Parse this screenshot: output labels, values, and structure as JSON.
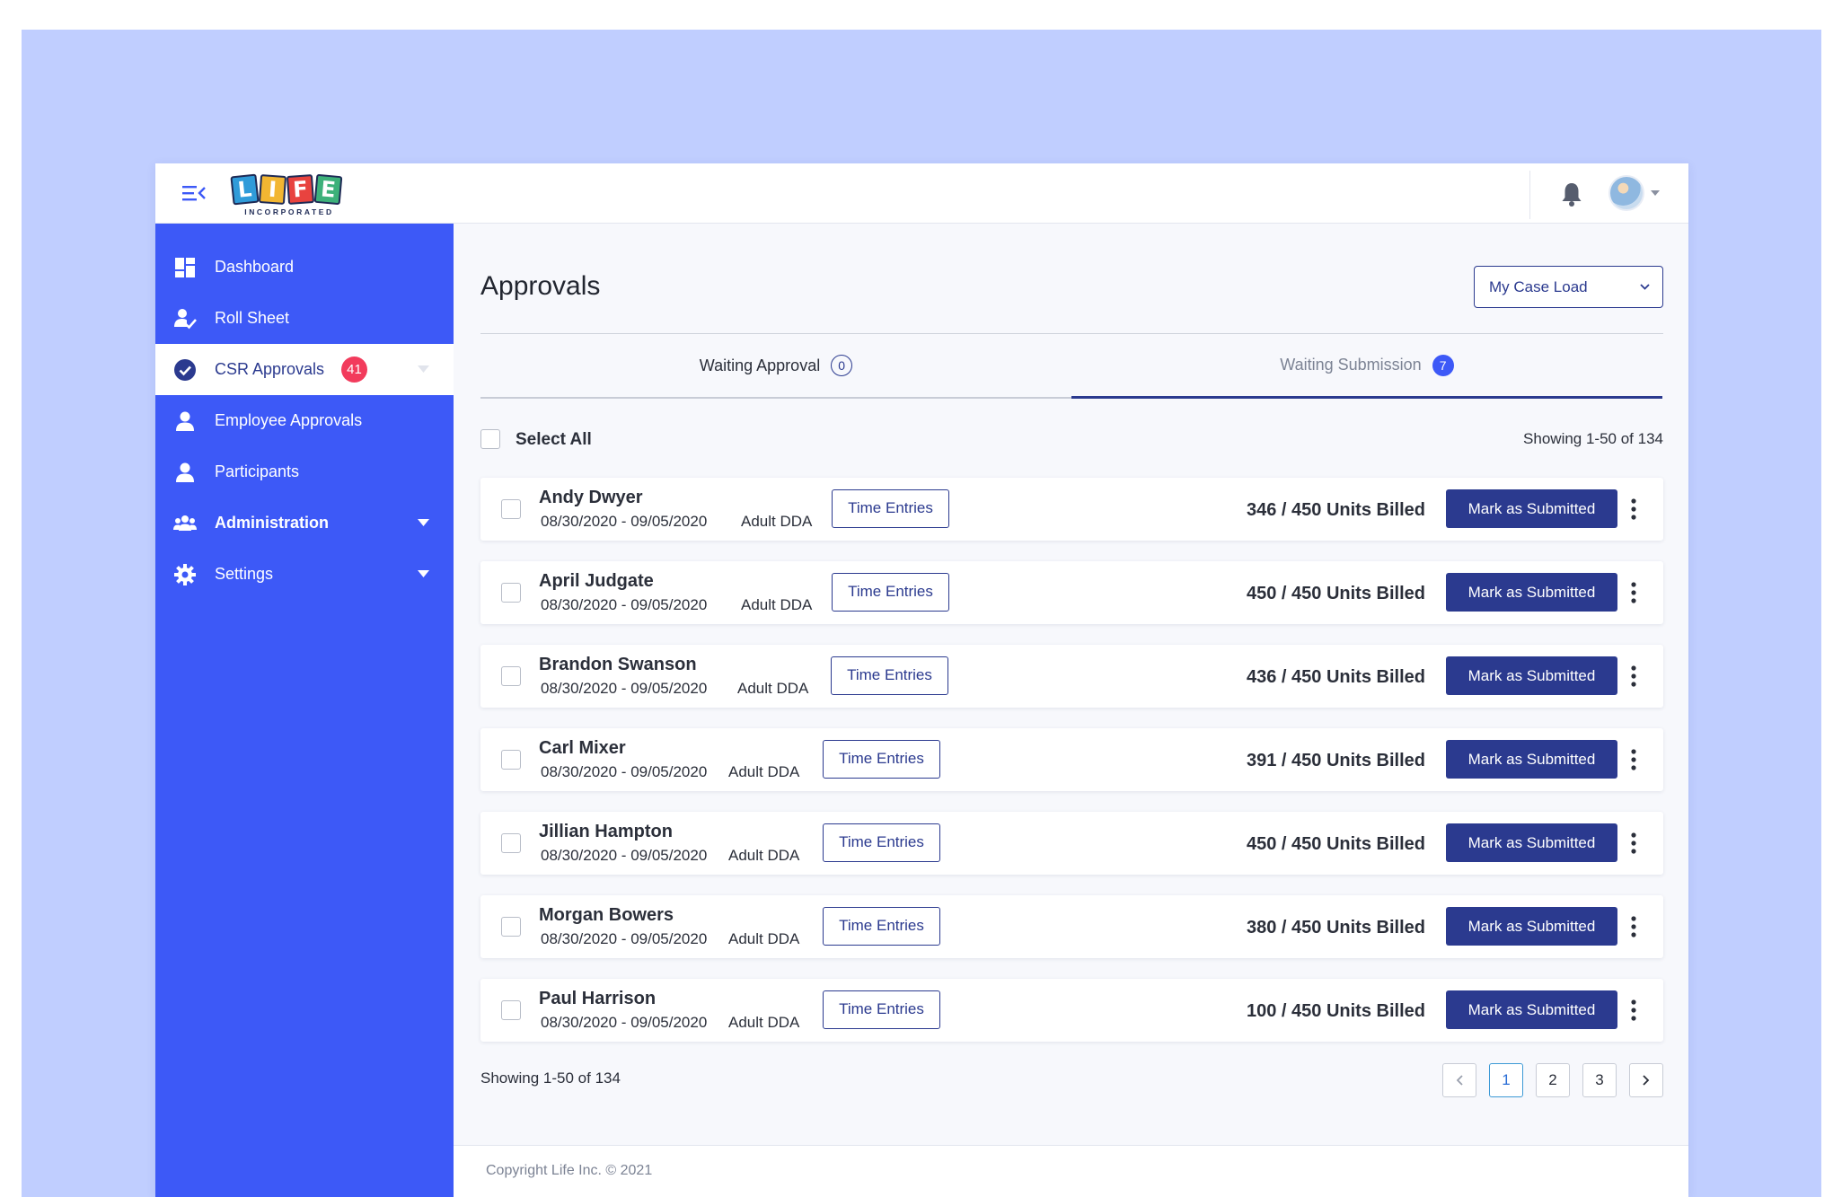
{
  "brand": {
    "letters": [
      "L",
      "I",
      "F",
      "E"
    ],
    "letter_colors": [
      "#2f9bd9",
      "#f2b632",
      "#e8433f",
      "#3db17a"
    ],
    "subtitle": "INCORPORATED"
  },
  "colors": {
    "sidebar": "#3d59f7",
    "primary": "#2b3a8f",
    "badge": "#f23b5c",
    "backdrop": "#c0ceff"
  },
  "sidebar": {
    "items": [
      {
        "label": "Dashboard",
        "icon": "dashboard-icon"
      },
      {
        "label": "Roll Sheet",
        "icon": "user-check-icon"
      },
      {
        "label": "CSR Approvals",
        "icon": "check-circle-icon",
        "badge": "41",
        "active": true
      },
      {
        "label": "Employee Approvals",
        "icon": "user-icon"
      },
      {
        "label": "Participants",
        "icon": "user-icon"
      },
      {
        "label": "Administration",
        "icon": "group-icon",
        "expandable": true
      },
      {
        "label": "Settings",
        "icon": "gear-icon",
        "expandable": true
      }
    ]
  },
  "header": {
    "page_title": "Approvals",
    "filter_selected": "My Case Load"
  },
  "tabs": [
    {
      "label": "Waiting Approval",
      "count": "0"
    },
    {
      "label": "Waiting Submission",
      "count": "7",
      "active": true
    }
  ],
  "list": {
    "select_all_label": "Select All",
    "showing": "Showing 1-50 of 134",
    "time_entries_label": "Time Entries",
    "submit_label": "Mark as Submitted",
    "rows": [
      {
        "name": "Andy Dwyer",
        "dates": "08/30/2020 - 09/05/2020",
        "program": "Adult DDA",
        "units": "346 / 450 Units Billed"
      },
      {
        "name": "April Judgate",
        "dates": "08/30/2020 - 09/05/2020",
        "program": "Adult DDA",
        "units": "450 / 450 Units Billed"
      },
      {
        "name": "Brandon Swanson",
        "dates": "08/30/2020 - 09/05/2020",
        "program": "Adult DDA",
        "units": "436 / 450 Units Billed"
      },
      {
        "name": "Carl Mixer",
        "dates": "08/30/2020 - 09/05/2020",
        "program": "Adult DDA",
        "units": "391 / 450 Units Billed"
      },
      {
        "name": "Jillian Hampton",
        "dates": "08/30/2020 - 09/05/2020",
        "program": "Adult DDA",
        "units": "450 / 450 Units Billed"
      },
      {
        "name": "Morgan Bowers",
        "dates": "08/30/2020 - 09/05/2020",
        "program": "Adult DDA",
        "units": "380 / 450 Units Billed"
      },
      {
        "name": "Paul Harrison",
        "dates": "08/30/2020 - 09/05/2020",
        "program": "Adult DDA",
        "units": "100 / 450 Units Billed"
      }
    ]
  },
  "pagination": {
    "pages": [
      "1",
      "2",
      "3"
    ],
    "current": "1"
  },
  "footer": {
    "copyright": "Copyright Life Inc. © 2021"
  }
}
